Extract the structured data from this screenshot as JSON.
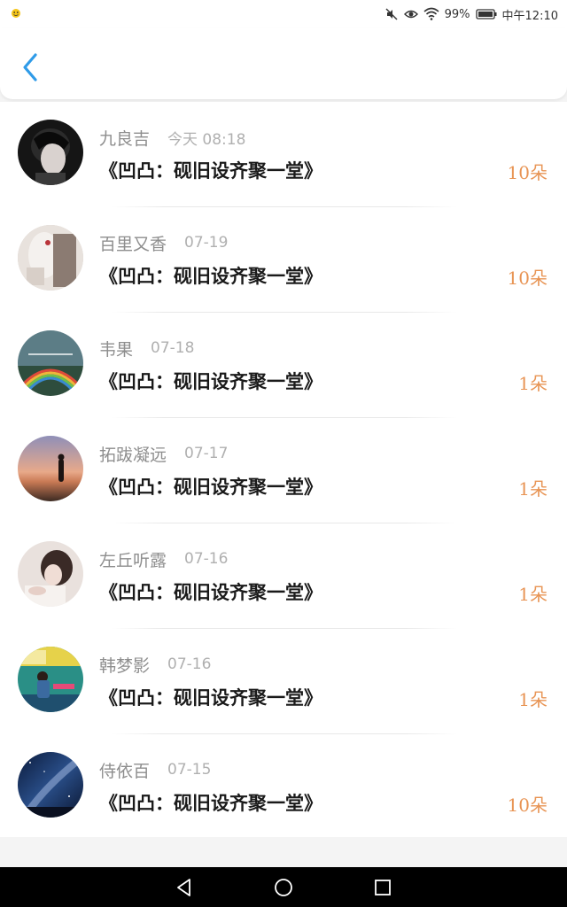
{
  "status_bar": {
    "battery": "99%",
    "time": "中午12:10"
  },
  "header": {
    "back_icon": "chevron-left-icon",
    "accent_color": "#2f9be8"
  },
  "list": {
    "items": [
      {
        "name": "九良吉",
        "time": "今天 08:18",
        "title": "《凹凸：砚旧设齐聚一堂》",
        "count": "10朵"
      },
      {
        "name": "百里又香",
        "time": "07-19",
        "title": "《凹凸：砚旧设齐聚一堂》",
        "count": "10朵"
      },
      {
        "name": "韦果",
        "time": "07-18",
        "title": "《凹凸：砚旧设齐聚一堂》",
        "count": "1朵"
      },
      {
        "name": "拓跋凝远",
        "time": "07-17",
        "title": "《凹凸：砚旧设齐聚一堂》",
        "count": "1朵"
      },
      {
        "name": "左丘听露",
        "time": "07-16",
        "title": "《凹凸：砚旧设齐聚一堂》",
        "count": "1朵"
      },
      {
        "name": "韩梦影",
        "time": "07-16",
        "title": "《凹凸：砚旧设齐聚一堂》",
        "count": "1朵"
      },
      {
        "name": "侍依百",
        "time": "07-15",
        "title": "《凹凸：砚旧设齐聚一堂》",
        "count": "10朵"
      }
    ]
  },
  "nav_bar": {
    "back": "triangle-back-icon",
    "home": "circle-home-icon",
    "recents": "square-recents-icon"
  },
  "colors": {
    "count": "#e89454",
    "name": "#8e8e8e",
    "time": "#b0b0b0",
    "title": "#1a1a1a"
  }
}
